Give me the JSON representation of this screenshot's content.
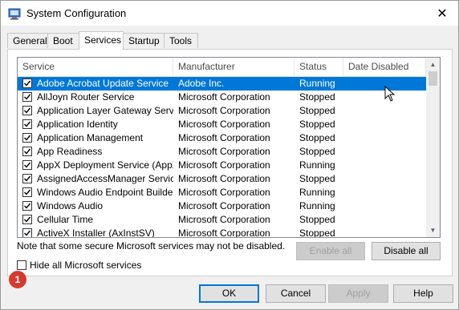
{
  "window": {
    "title": "System Configuration",
    "close_glyph": "✕"
  },
  "tabs": [
    {
      "label": "General"
    },
    {
      "label": "Boot"
    },
    {
      "label": "Services"
    },
    {
      "label": "Startup"
    },
    {
      "label": "Tools"
    }
  ],
  "columns": {
    "service": "Service",
    "manufacturer": "Manufacturer",
    "status": "Status",
    "date_disabled": "Date Disabled"
  },
  "services": [
    {
      "name": "Adobe Acrobat Update Service",
      "manufacturer": "Adobe Inc.",
      "status": "Running",
      "date": "",
      "checked": true
    },
    {
      "name": "AllJoyn Router Service",
      "manufacturer": "Microsoft Corporation",
      "status": "Stopped",
      "date": "",
      "checked": true
    },
    {
      "name": "Application Layer Gateway Service",
      "manufacturer": "Microsoft Corporation",
      "status": "Stopped",
      "date": "",
      "checked": true
    },
    {
      "name": "Application Identity",
      "manufacturer": "Microsoft Corporation",
      "status": "Stopped",
      "date": "",
      "checked": true
    },
    {
      "name": "Application Management",
      "manufacturer": "Microsoft Corporation",
      "status": "Stopped",
      "date": "",
      "checked": true
    },
    {
      "name": "App Readiness",
      "manufacturer": "Microsoft Corporation",
      "status": "Stopped",
      "date": "",
      "checked": true
    },
    {
      "name": "AppX Deployment Service (AppX...",
      "manufacturer": "Microsoft Corporation",
      "status": "Running",
      "date": "",
      "checked": true
    },
    {
      "name": "AssignedAccessManager Service",
      "manufacturer": "Microsoft Corporation",
      "status": "Stopped",
      "date": "",
      "checked": true
    },
    {
      "name": "Windows Audio Endpoint Builder",
      "manufacturer": "Microsoft Corporation",
      "status": "Running",
      "date": "",
      "checked": true
    },
    {
      "name": "Windows Audio",
      "manufacturer": "Microsoft Corporation",
      "status": "Running",
      "date": "",
      "checked": true
    },
    {
      "name": "Cellular Time",
      "manufacturer": "Microsoft Corporation",
      "status": "Stopped",
      "date": "",
      "checked": true
    },
    {
      "name": "ActiveX Installer (AxInstSV)",
      "manufacturer": "Microsoft Corporation",
      "status": "Stopped",
      "date": "",
      "checked": true
    }
  ],
  "selected_index": 0,
  "note": "Note that some secure Microsoft services may not be disabled.",
  "buttons": {
    "enable_all": "Enable all",
    "disable_all": "Disable all",
    "ok": "OK",
    "cancel": "Cancel",
    "apply": "Apply",
    "help": "Help"
  },
  "hide_ms_label": "Hide all Microsoft services",
  "hide_ms_checked": false,
  "badge_number": "1",
  "colors": {
    "selection": "#0078d7",
    "badge": "#d43a2f"
  }
}
